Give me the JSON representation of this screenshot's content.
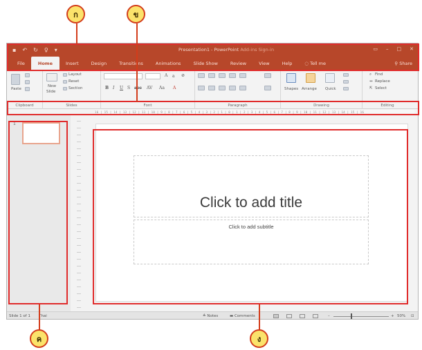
{
  "callouts": {
    "a": "ก",
    "b": "ข",
    "c": "ค",
    "d": "ง"
  },
  "titlebar": {
    "qat": [
      "▪",
      "↶",
      "↻",
      "♀",
      "▾"
    ],
    "doc_name": "Presentation1",
    "separator": " - ",
    "app_name": "PowerPoint",
    "extra": "  Add-ins  Sign-in"
  },
  "tabs": [
    "File",
    "Home",
    "Insert",
    "Design",
    "Transitions",
    "Animations",
    "Slide Show",
    "Review",
    "View",
    "Help"
  ],
  "tell_me": "Tell me",
  "share": "Share",
  "ribbon": {
    "groups": [
      "Clipboard",
      "Slides",
      "Font",
      "Paragraph",
      "Drawing",
      "Editing"
    ],
    "paste": "Paste",
    "new_slide": "New",
    "new_slide_2": "Slide",
    "layout": "Layout",
    "reset": "Reset",
    "section": "Section",
    "shapes": "Shapes",
    "arrange": "Arrange",
    "quick": "Quick",
    "find": "Find",
    "replace": "Replace",
    "select": "Select"
  },
  "ruler_text": "16 | 15 | 14 | 13 | 12 | 11 | 10 | 9 | 8 | 7 | 6 | 5 | 4 | 3 | 2 | 1 | 0 | 1 | 2 | 3 | 4 | 5 | 6 | 7 | 8 | 9 | 10 | 11 | 12 | 13 | 14 | 15 | 16",
  "thumbnail": {
    "number": "1"
  },
  "slide": {
    "title_placeholder": "Click to add title",
    "subtitle_placeholder": "Click to add subtitle"
  },
  "status": {
    "slide_of": "Slide 1 of 1",
    "language": "Thai",
    "notes": "Notes",
    "comments": "Comments",
    "zoom_minus": "–",
    "zoom_plus": "+",
    "zoom": "50%"
  },
  "colors": {
    "accent": "#b7472a",
    "callout": "#e02b2b",
    "marker_fill": "#fbe36b"
  }
}
